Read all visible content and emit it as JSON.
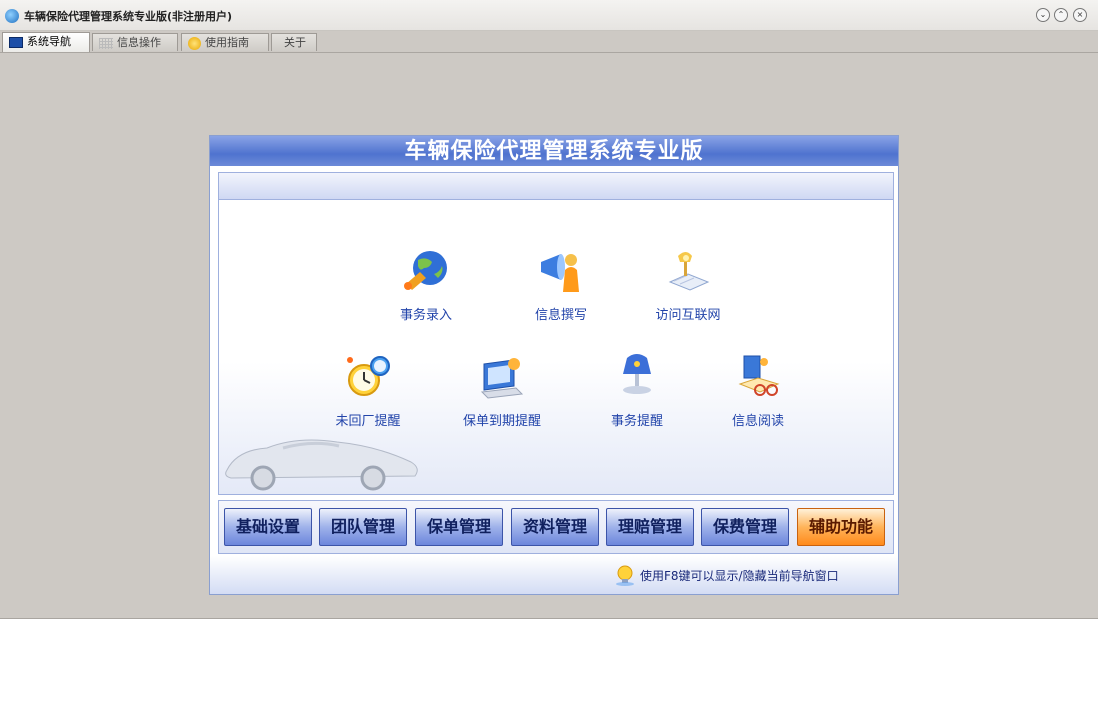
{
  "window": {
    "title": "车辆保险代理管理系统专业版(非注册用户)",
    "buttons": [
      "⌄",
      "⌃",
      "×"
    ]
  },
  "tabs": [
    {
      "label": "系统导航",
      "active": true
    },
    {
      "label": "信息操作",
      "active": false
    },
    {
      "label": "使用指南",
      "active": false
    },
    {
      "label": "关于",
      "active": false
    }
  ],
  "panel": {
    "title": "车辆保险代理管理系统专业版",
    "icons": [
      {
        "label": "事务录入",
        "icon": "globe-icon"
      },
      {
        "label": "信息撰写",
        "icon": "megaphone-icon"
      },
      {
        "label": "访问互联网",
        "icon": "book-lamp-icon"
      },
      {
        "label": "未回厂提醒",
        "icon": "alarm-clock-icon"
      },
      {
        "label": "保单到期提醒",
        "icon": "monitor-icon"
      },
      {
        "label": "事务提醒",
        "icon": "lamp-icon"
      },
      {
        "label": "信息阅读",
        "icon": "reading-icon"
      }
    ],
    "buttons": [
      "基础设置",
      "团队管理",
      "保单管理",
      "资料管理",
      "理赔管理",
      "保费管理",
      "辅助功能"
    ],
    "footer_text": "使用F8键可以显示/隐藏当前导航窗口"
  },
  "colors": {
    "accent": "#4f73cf",
    "highlight": "#ff8a1c"
  }
}
